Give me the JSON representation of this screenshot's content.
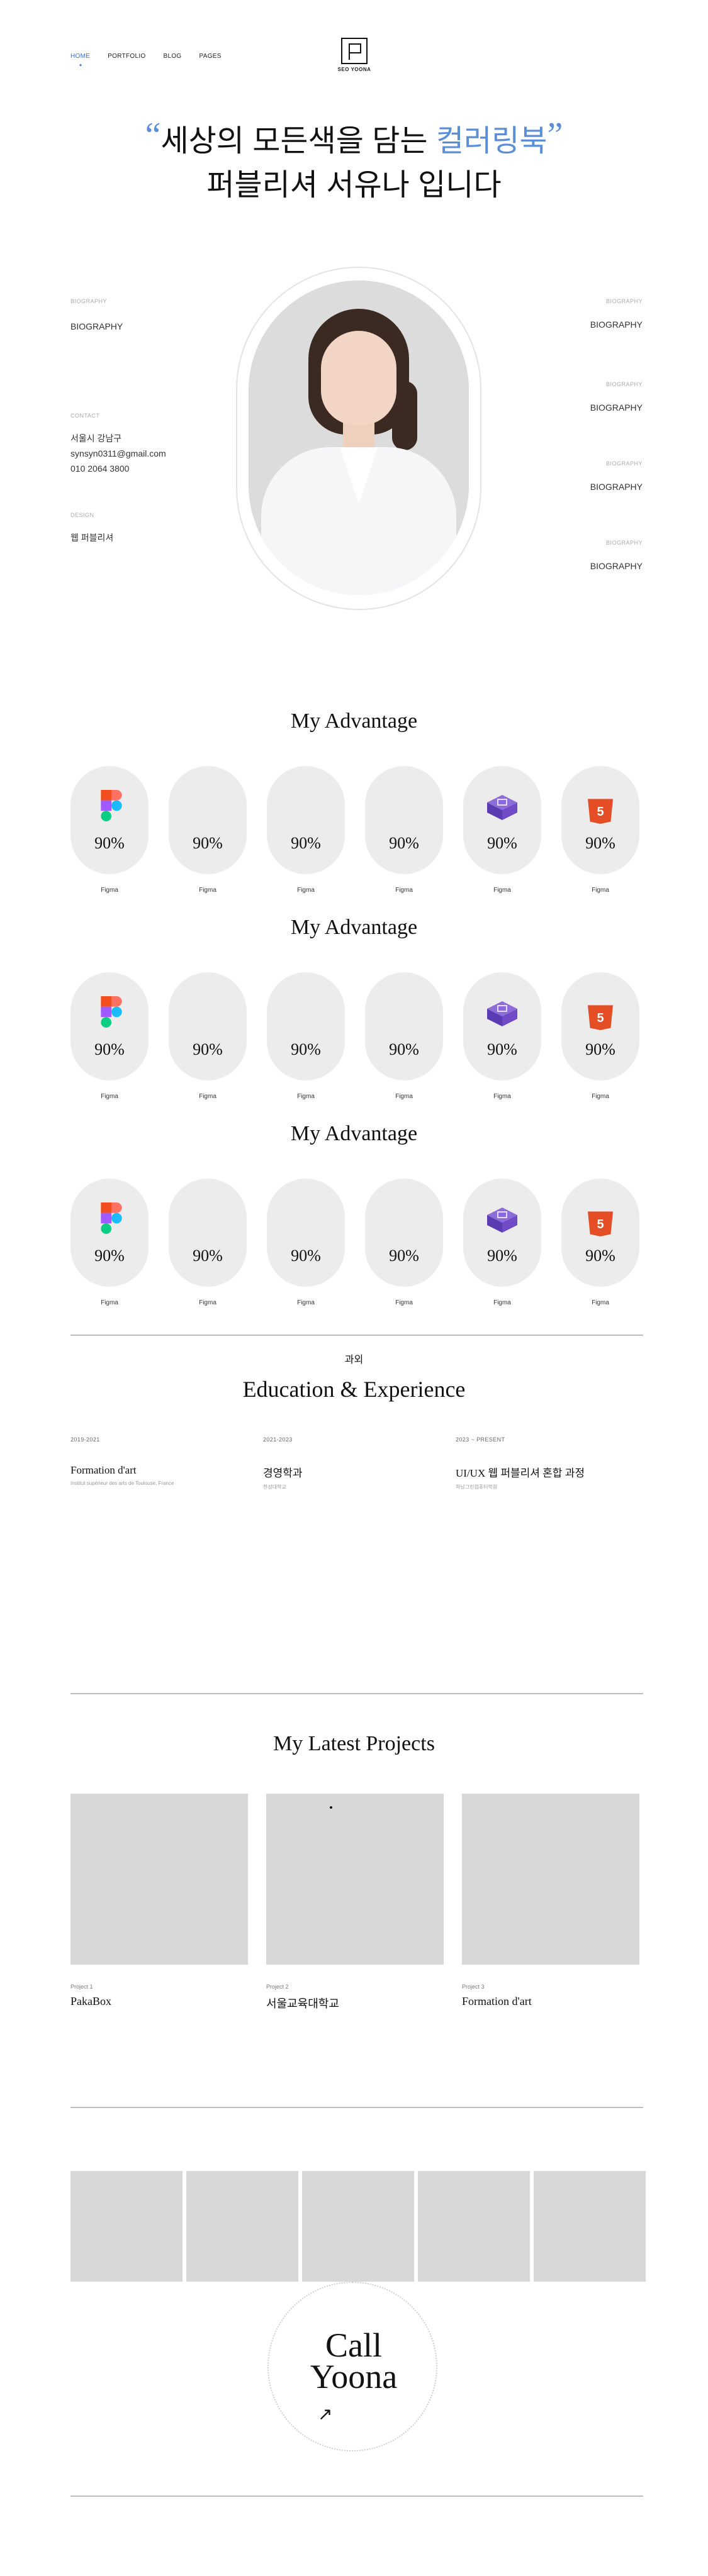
{
  "nav": {
    "items": [
      {
        "label": "HOME"
      },
      {
        "label": "PORTFOLIO"
      },
      {
        "label": "BLOG"
      },
      {
        "label": "PAGES"
      }
    ],
    "logo_text": "SEO YOONA"
  },
  "hero": {
    "open_quote": "“",
    "line1_prefix": "세상의 모든색을 담는 ",
    "line1_accent": "컬러링북",
    "close_quote": "”",
    "line2": "퍼블리셔 서유나 입니다",
    "accent_color": "#5b8ed6"
  },
  "bio": {
    "left": [
      {
        "label": "BIOGRAPHY",
        "lines": [
          "BIOGRAPHY"
        ]
      },
      {
        "label": "CONTACT",
        "lines": [
          "서울시 강남구",
          "synsyn0311@gmail.com",
          "010 2064 3800"
        ]
      },
      {
        "label": "DESIGN",
        "lines": [
          "웹 퍼블리셔"
        ]
      }
    ],
    "right": [
      {
        "label": "BIOGRAPHY",
        "value": "BIOGRAPHY"
      },
      {
        "label": "BIOGRAPHY",
        "value": "BIOGRAPHY"
      },
      {
        "label": "BIOGRAPHY",
        "value": "BIOGRAPHY"
      },
      {
        "label": "BIOGRAPHY",
        "value": "BIOGRAPHY"
      }
    ]
  },
  "advantage": {
    "title": "My Advantage",
    "skills": [
      {
        "icon": "figma-icon",
        "percent": "90%",
        "label": "Figma"
      },
      {
        "icon": "none",
        "percent": "90%",
        "label": "Figma"
      },
      {
        "icon": "none",
        "percent": "90%",
        "label": "Figma"
      },
      {
        "icon": "none",
        "percent": "90%",
        "label": "Figma"
      },
      {
        "icon": "purple-cube-icon",
        "percent": "90%",
        "label": "Figma"
      },
      {
        "icon": "html5-icon",
        "percent": "90%",
        "label": "Figma"
      }
    ]
  },
  "education": {
    "small": "과외",
    "title": "Education & Experience",
    "items": [
      {
        "date": "2019-2021",
        "title": "Formation d'art",
        "sub": "Institut supérieur des arts de Toulouse, France"
      },
      {
        "date": "2021-2023",
        "title": "경영학과",
        "sub": "한성대학교"
      },
      {
        "date": "2023 ~ PRESENT",
        "title": "UI/UX 웹 퍼블리셔 혼합 과정",
        "sub": "하남그린컴퓨터학원"
      }
    ]
  },
  "projects": {
    "title": "My Latest Projects",
    "items": [
      {
        "label": "Project 1",
        "name": "PakaBox"
      },
      {
        "label": "Project 2",
        "name": "서울교육대학교"
      },
      {
        "label": "Project 3",
        "name": "Formation d'art"
      }
    ]
  },
  "call": {
    "line1": "Call",
    "line2": "Yoona",
    "arrow": "↗"
  }
}
